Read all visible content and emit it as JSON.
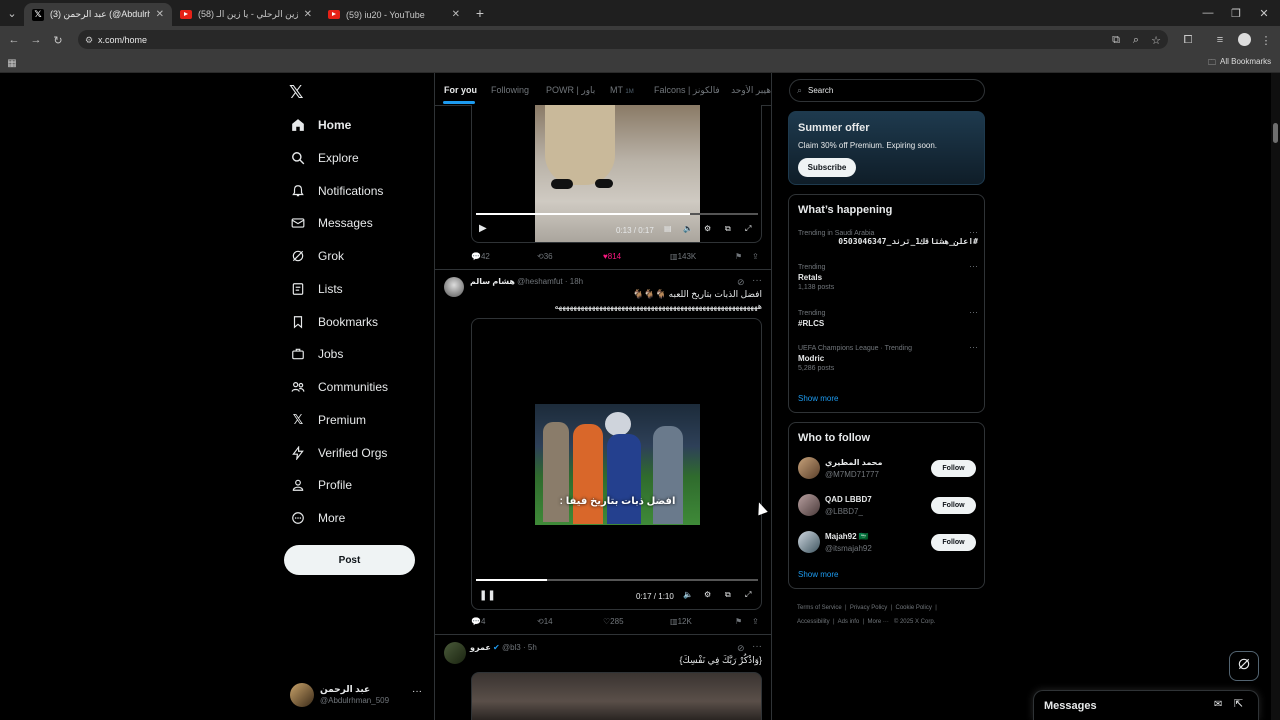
{
  "browser": {
    "tabs": [
      {
        "title": "(3) عبد الرحمن (@Abdulrhman_509",
        "active": true,
        "favicon": "x-logo"
      },
      {
        "title": "(58) عمل زين الرحلي - يا زين الـ",
        "active": false,
        "favicon": "youtube-logo"
      },
      {
        "title": "(59) iu20 - YouTube",
        "active": false,
        "favicon": "youtube-logo"
      }
    ],
    "url": "x.com/home",
    "bookmarks_label": "All Bookmarks"
  },
  "nav": {
    "items": [
      {
        "label": "Home",
        "icon": "home-icon"
      },
      {
        "label": "Explore",
        "icon": "search-icon"
      },
      {
        "label": "Notifications",
        "icon": "bell-icon"
      },
      {
        "label": "Messages",
        "icon": "envelope-icon"
      },
      {
        "label": "Grok",
        "icon": "grok-icon"
      },
      {
        "label": "Lists",
        "icon": "list-icon"
      },
      {
        "label": "Bookmarks",
        "icon": "bookmark-icon"
      },
      {
        "label": "Jobs",
        "icon": "briefcase-icon"
      },
      {
        "label": "Communities",
        "icon": "people-icon"
      },
      {
        "label": "Premium",
        "icon": "x-logo-icon"
      },
      {
        "label": "Verified Orgs",
        "icon": "lightning-icon"
      },
      {
        "label": "Profile",
        "icon": "person-icon"
      },
      {
        "label": "More",
        "icon": "more-circle-icon"
      }
    ],
    "post_label": "Post",
    "account": {
      "name": "عبد الرحمن",
      "handle": "@Abdulrhman_509"
    }
  },
  "feed": {
    "tabs": [
      "For you",
      "Following",
      "POWR | باور",
      "MT",
      "Falcons | فالكونز",
      "هيبر الأوحد"
    ],
    "tab_mt_suffix": "1M",
    "post1": {
      "video_time": "0:13 / 0:17",
      "replies": "42",
      "reposts": "36",
      "likes": "814",
      "views": "143K"
    },
    "post2": {
      "name": "هشام سالم",
      "handle": "@heshamfut",
      "time": "18h",
      "text_line1": "افضل الذبات بتاريخ اللعبه 🐐🐐🐐",
      "text_line2": "هههههههههههههههههههههههههههههههههههههههههههههههههههههههه",
      "caption": "افضل ذبات بتاريخ فيفا :",
      "video_time": "0:17 / 1:10",
      "replies": "4",
      "reposts": "14",
      "likes": "285",
      "views": "12K"
    },
    "post3": {
      "name": "عمرو",
      "handle": "@bl3",
      "time": "5h",
      "text": "{وَاذْكُرْ رَبَّكَ فِي نَفْسِكَ}"
    }
  },
  "sidebar": {
    "search_placeholder": "Search",
    "premium": {
      "title": "Summer offer",
      "text": "Claim 30% off Premium. Expiring soon.",
      "button": "Subscribe"
    },
    "trends_title": "What’s happening",
    "trends": [
      {
        "context": "Trending in Saudi Arabia",
        "name": "#اعلن_هشتاقك1_ترند_0503046347",
        "posts": ""
      },
      {
        "context": "Trending",
        "name": "Retals",
        "posts": "1,138 posts"
      },
      {
        "context": "Trending",
        "name": "#RLCS",
        "posts": ""
      },
      {
        "context": "UEFA Champions League · Trending",
        "name": "Modric",
        "posts": "5,286 posts"
      }
    ],
    "show_more": "Show more",
    "who_title": "Who to follow",
    "who": [
      {
        "name": "محمد المطيري",
        "handle": "@M7MD71777",
        "button": "Follow"
      },
      {
        "name": "QAD LBBD7",
        "handle": "@LBBD7_",
        "button": "Follow"
      },
      {
        "name": "Majah92 🇸🇦",
        "handle": "@itsmajah92",
        "button": "Follow"
      }
    ],
    "footer": [
      "Terms of Service",
      "Privacy Policy",
      "Cookie Policy",
      "Accessibility",
      "Ads info",
      "More ···",
      "© 2025 X Corp."
    ]
  },
  "messages_drawer": {
    "title": "Messages"
  }
}
